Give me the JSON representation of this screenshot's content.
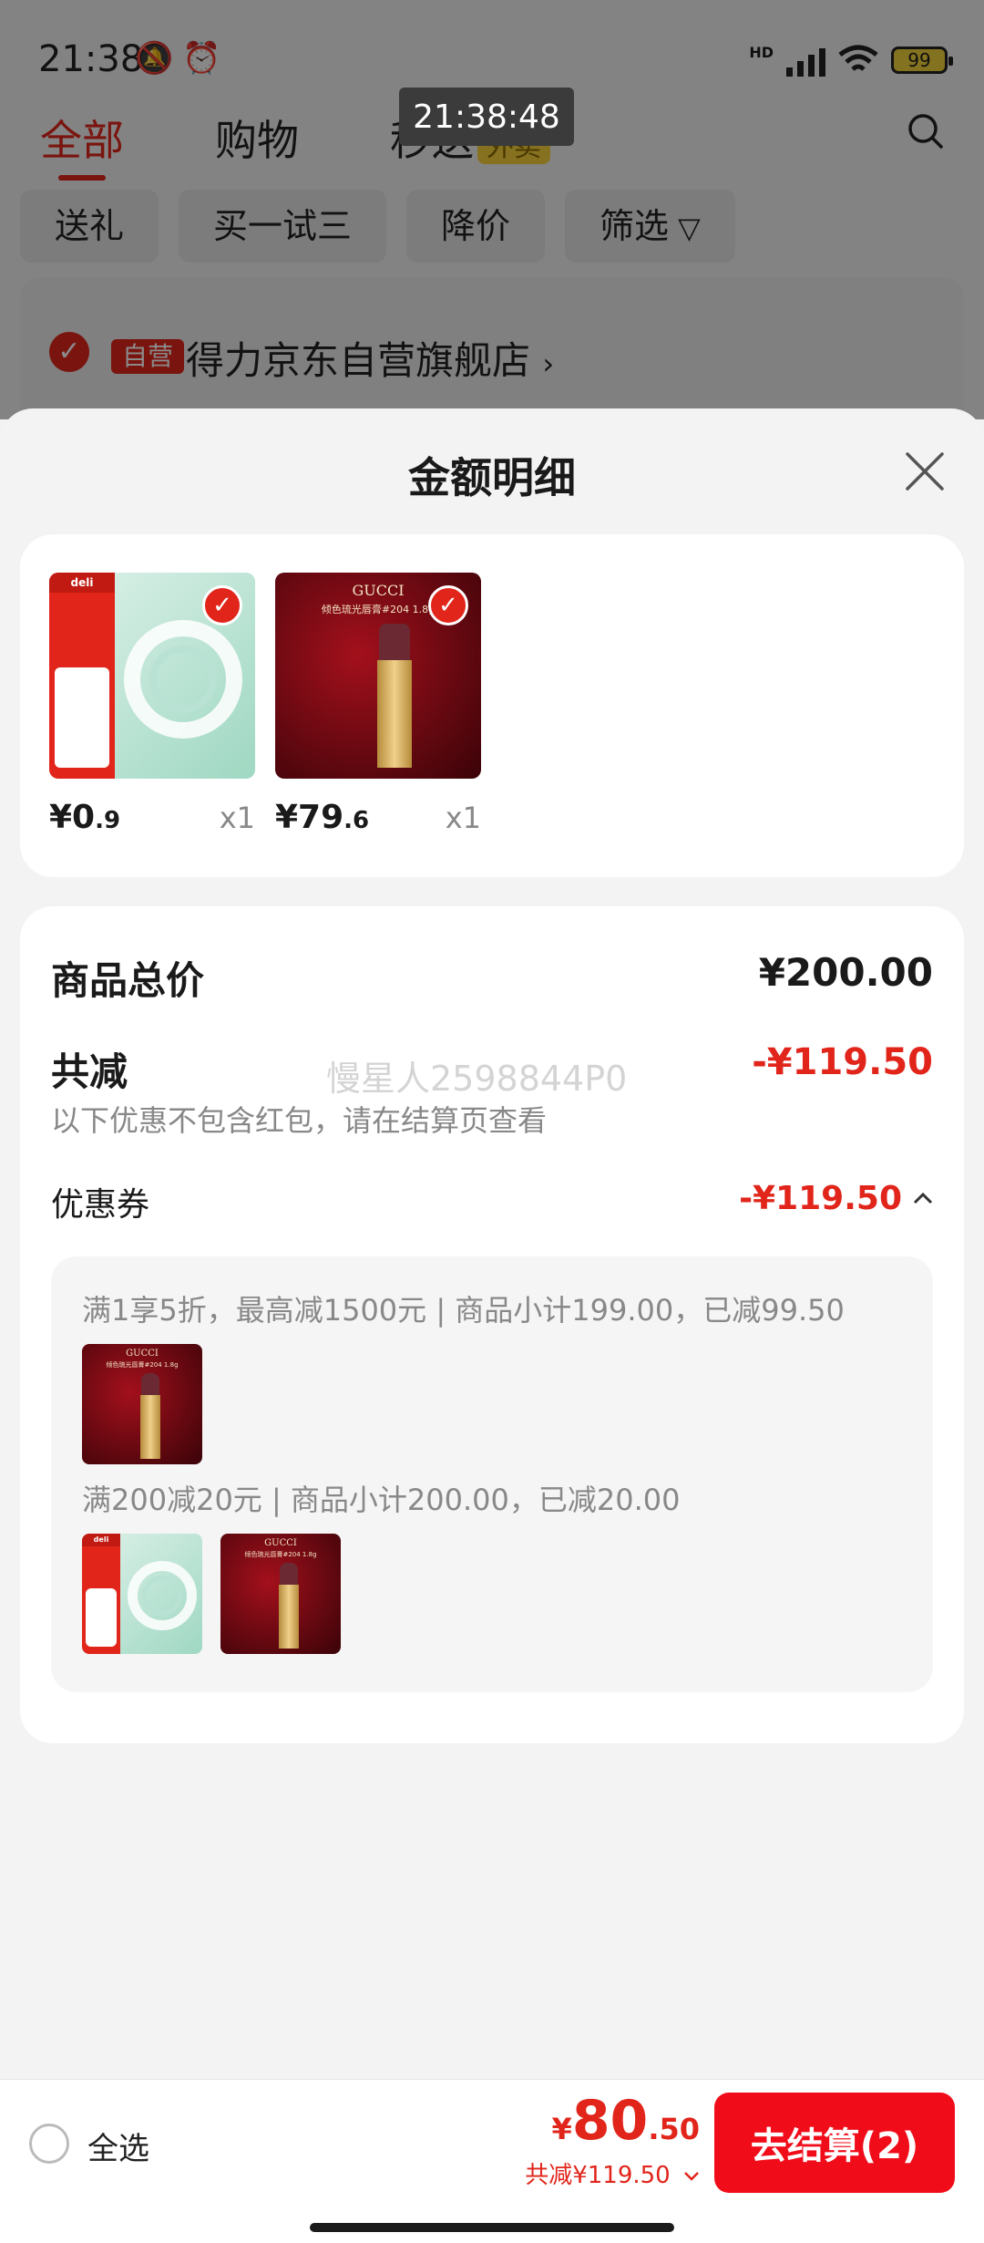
{
  "status_bar": {
    "time": "21:38",
    "battery": "99",
    "network": "HD"
  },
  "overlay_timestamp": "21:38:48",
  "tabs": [
    {
      "label": "全部",
      "active": true
    },
    {
      "label": "购物"
    },
    {
      "label": "秒送",
      "badge": "外卖"
    }
  ],
  "filters": [
    "送礼",
    "买一试三",
    "降价",
    "筛选"
  ],
  "store": {
    "badge": "自营",
    "name": "得力京东自营旗舰店",
    "arrow": "›"
  },
  "sheet": {
    "title": "金额明细",
    "products": [
      {
        "name": "tape",
        "price_int": "¥0",
        "price_dec": ".9",
        "qty": "x1"
      },
      {
        "name": "lipstick",
        "price_int": "¥79",
        "price_dec": ".6",
        "qty": "x1"
      }
    ],
    "total": {
      "label": "商品总价",
      "value": "¥200.00"
    },
    "reduce": {
      "label": "共减",
      "value": "-¥119.50",
      "note": "以下优惠不包含红包，请在结算页查看"
    },
    "watermark": "慢星人2598844P0",
    "coupon": {
      "label": "优惠券",
      "value": "-¥119.50",
      "lines": [
        "满1享5折，最高减1500元 | 商品小计199.00，已减99.50",
        "满200减20元 | 商品小计200.00，已减20.00"
      ]
    },
    "image_text": {
      "tape_brand": "deli",
      "lip_brand": "GUCCI",
      "lip_sub": "倾色琉光唇膏#204 1.8g"
    }
  },
  "bottom_bar": {
    "select_all": "全选",
    "yen": "¥",
    "price_int": "80",
    "price_dec": ".50",
    "saved": "共减¥119.50",
    "checkout": "去结算(2)"
  },
  "colors": {
    "accent": "#e1251b",
    "checkout": "#f10c19"
  }
}
